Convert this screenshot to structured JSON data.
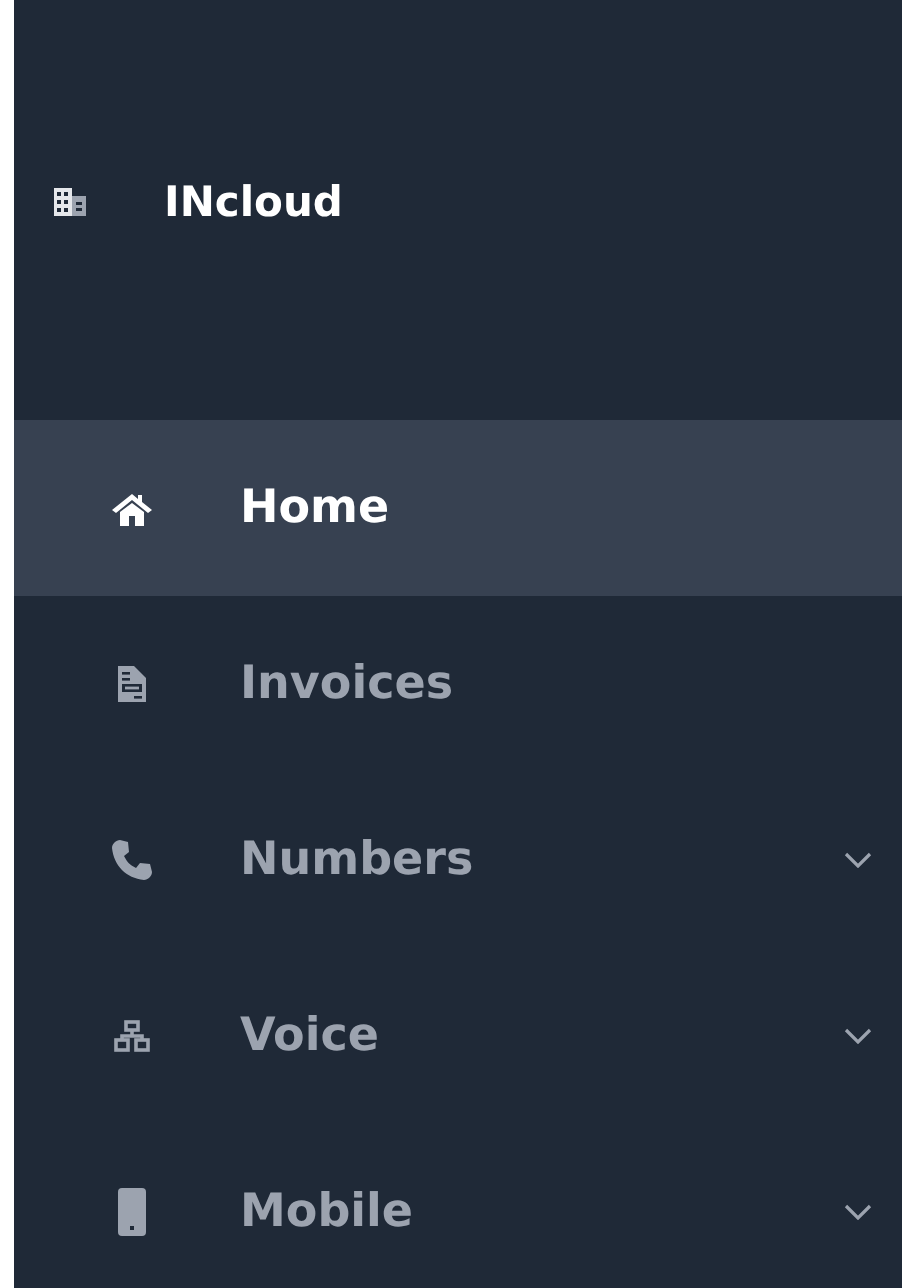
{
  "brand": {
    "name": "INcloud"
  },
  "menu": [
    {
      "label": "Home",
      "selected": true,
      "expandable": false
    },
    {
      "label": "Invoices",
      "selected": false,
      "expandable": false
    },
    {
      "label": "Numbers",
      "selected": false,
      "expandable": true
    },
    {
      "label": "Voice",
      "selected": false,
      "expandable": true
    },
    {
      "label": "Mobile",
      "selected": false,
      "expandable": true
    }
  ]
}
